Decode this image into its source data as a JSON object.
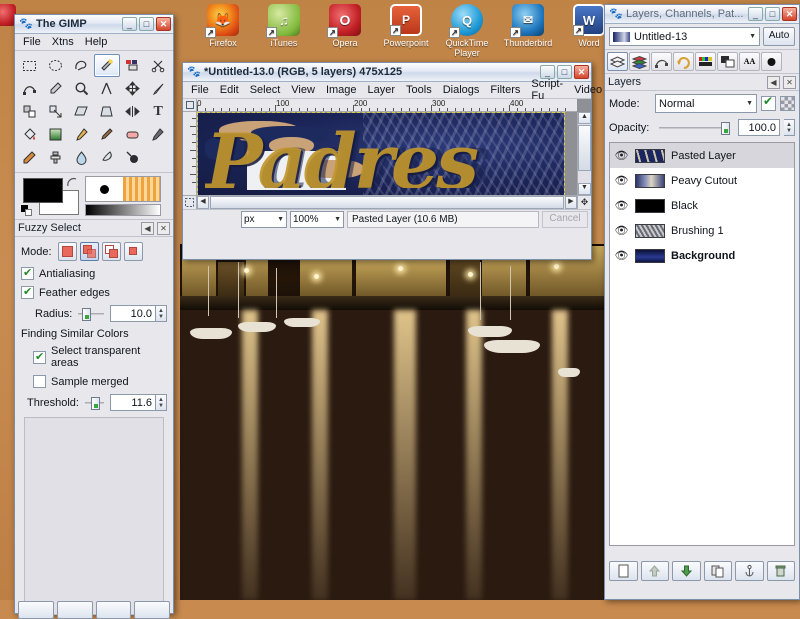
{
  "desktop": {
    "icons": [
      {
        "name": "Firefox",
        "glyph": "firefox-icon",
        "color": "#e06a12"
      },
      {
        "name": "iTunes",
        "glyph": "itunes-icon",
        "color": "#8fc63d"
      },
      {
        "name": "Opera",
        "glyph": "opera-icon",
        "color": "#c32026"
      },
      {
        "name": "Powerpoint",
        "glyph": "powerpoint-icon",
        "color": "#d24625"
      },
      {
        "name": "QuickTime Player",
        "glyph": "quicktime-icon",
        "color": "#1f9ad6"
      },
      {
        "name": "Thunderbird",
        "glyph": "thunderbird-icon",
        "color": "#1c75bc"
      },
      {
        "name": "Word",
        "glyph": "word-icon",
        "color": "#2b5797"
      }
    ],
    "shortcut_badge": "↗"
  },
  "toolbox": {
    "title": "The GIMP",
    "window_buttons": [
      "_",
      "□",
      "✕"
    ],
    "menus": [
      "File",
      "Xtns",
      "Help"
    ],
    "tools": [
      {
        "name": "rect-select-tool",
        "selected": false
      },
      {
        "name": "ellipse-select-tool",
        "selected": false
      },
      {
        "name": "free-select-tool",
        "selected": false
      },
      {
        "name": "fuzzy-select-tool",
        "selected": true
      },
      {
        "name": "select-by-color-tool",
        "selected": false
      },
      {
        "name": "scissors-select-tool",
        "selected": false
      },
      {
        "name": "paths-tool",
        "selected": false
      },
      {
        "name": "color-picker-tool",
        "selected": false
      },
      {
        "name": "zoom-tool",
        "selected": false
      },
      {
        "name": "measure-tool",
        "selected": false
      },
      {
        "name": "move-tool",
        "selected": false
      },
      {
        "name": "crop-tool",
        "selected": false
      },
      {
        "name": "rotate-tool",
        "selected": false
      },
      {
        "name": "scale-tool",
        "selected": false
      },
      {
        "name": "shear-tool",
        "selected": false
      },
      {
        "name": "perspective-tool",
        "selected": false
      },
      {
        "name": "flip-tool",
        "selected": false
      },
      {
        "name": "text-tool",
        "selected": false
      },
      {
        "name": "bucket-fill-tool",
        "selected": false
      },
      {
        "name": "blend-tool",
        "selected": false
      },
      {
        "name": "pencil-tool",
        "selected": false
      },
      {
        "name": "paintbrush-tool",
        "selected": false
      },
      {
        "name": "eraser-tool",
        "selected": false
      },
      {
        "name": "airbrush-tool",
        "selected": false
      },
      {
        "name": "ink-tool",
        "selected": false
      },
      {
        "name": "clone-tool",
        "selected": false
      },
      {
        "name": "blur-sharpen-tool",
        "selected": false
      },
      {
        "name": "smudge-tool",
        "selected": false
      },
      {
        "name": "dodge-burn-tool",
        "selected": false
      }
    ],
    "foreground_color": "#000000",
    "background_color": "#ffffff"
  },
  "tool_options": {
    "title": "Fuzzy Select",
    "mode_label": "Mode:",
    "modes": [
      "replace",
      "add",
      "subtract",
      "intersect"
    ],
    "selected_mode_index": 1,
    "antialiasing_label": "Antialiasing",
    "antialiasing_checked": true,
    "feather_label": "Feather edges",
    "feather_checked": true,
    "radius_label": "Radius:",
    "radius_value": "10.0",
    "section_label": "Finding Similar Colors",
    "transparent_label": "Select transparent areas",
    "transparent_checked": true,
    "sample_merged_label": "Sample merged",
    "sample_merged_checked": false,
    "threshold_label": "Threshold:",
    "threshold_value": "11.6"
  },
  "image_window": {
    "title": "*Untitled-13.0 (RGB, 5 layers) 475x125",
    "window_buttons": [
      "_",
      "□",
      "✕"
    ],
    "menus": [
      "File",
      "Edit",
      "Select",
      "View",
      "Image",
      "Layer",
      "Tools",
      "Dialogs",
      "Filters",
      "Script-Fu",
      "Video"
    ],
    "ruler_marks": [
      "0",
      "100",
      "200",
      "300",
      "400"
    ],
    "unit": "px",
    "zoom": "100%",
    "status_text": "Pasted Layer (10.6 MB)",
    "cancel_label": "Cancel"
  },
  "layers_dock": {
    "title": "Layers, Channels, Pat...",
    "window_buttons": [
      "_",
      "□",
      "✕"
    ],
    "tabs": [
      "layers-tab",
      "channels-tab",
      "paths-tab",
      "undo-history-tab",
      "colormap-tab",
      "color-tab",
      "fonts-tab",
      "brushes-tab"
    ],
    "image_name": "Untitled-13",
    "auto_label": "Auto",
    "panel_title": "Layers",
    "mode_label": "Mode:",
    "mode_value": "Normal",
    "opacity_label": "Opacity:",
    "opacity_value": "100.0",
    "layers": [
      {
        "name": "Pasted Layer",
        "visible": true,
        "selected": true,
        "bold": false,
        "thumb": "pasted"
      },
      {
        "name": "Peavy Cutout",
        "visible": true,
        "selected": false,
        "bold": false,
        "thumb": "peavy"
      },
      {
        "name": "Black",
        "visible": true,
        "selected": false,
        "bold": false,
        "thumb": "black"
      },
      {
        "name": "Brushing 1",
        "visible": true,
        "selected": false,
        "bold": false,
        "thumb": "brush"
      },
      {
        "name": "Background",
        "visible": true,
        "selected": false,
        "bold": true,
        "thumb": "background"
      }
    ],
    "buttons": [
      {
        "name": "new-layer-button",
        "glyph": "🗋",
        "disabled": false
      },
      {
        "name": "raise-layer-button",
        "glyph": "⬆",
        "disabled": true
      },
      {
        "name": "lower-layer-button",
        "glyph": "⬇",
        "disabled": false
      },
      {
        "name": "duplicate-layer-button",
        "glyph": "⧉",
        "disabled": false
      },
      {
        "name": "anchor-layer-button",
        "glyph": "⚓",
        "disabled": false
      },
      {
        "name": "delete-layer-button",
        "glyph": "🗑",
        "disabled": false
      }
    ]
  }
}
